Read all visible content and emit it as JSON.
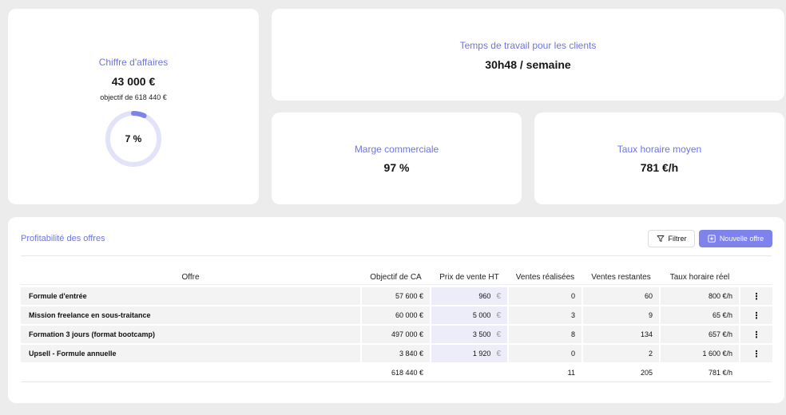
{
  "ca": {
    "title": "Chiffre d'affaires",
    "value": "43 000 €",
    "subtitle": "objectif de 618 440 €",
    "percent_label": "7 %",
    "percent": 0.07
  },
  "temps": {
    "title": "Temps de travail pour les clients",
    "value": "30h48 / semaine"
  },
  "marge": {
    "title": "Marge commerciale",
    "value": "97 %"
  },
  "taux": {
    "title": "Taux horaire moyen",
    "value": "781 €/h"
  },
  "table": {
    "title": "Profitabilité des offres",
    "filter_label": "Filtrer",
    "new_label": "Nouvelle offre",
    "headers": [
      "Offre",
      "Objectif de CA",
      "Prix de vente HT",
      "Ventes réalisées",
      "Ventes restantes",
      "Taux horaire réel"
    ],
    "rows": [
      {
        "offre": "Formule d'entrée",
        "objectif": "57 600 €",
        "prix": "960",
        "ventes": "0",
        "restantes": "60",
        "taux": "800 €/h"
      },
      {
        "offre": "Mission freelance en sous-traitance",
        "objectif": "60 000 €",
        "prix": "5 000",
        "ventes": "3",
        "restantes": "9",
        "taux": "65 €/h"
      },
      {
        "offre": "Formation 3 jours (format bootcamp)",
        "objectif": "497 000 €",
        "prix": "3 500",
        "ventes": "8",
        "restantes": "134",
        "taux": "657 €/h"
      },
      {
        "offre": "Upsell - Formule annuelle",
        "objectif": "3 840 €",
        "prix": "1 920",
        "ventes": "0",
        "restantes": "2",
        "taux": "1 600 €/h"
      }
    ],
    "currency_symbol": "€",
    "menu_symbol": "⋮",
    "totals": {
      "objectif": "618 440 €",
      "ventes": "11",
      "restantes": "205",
      "taux": "781 €/h"
    }
  },
  "colors": {
    "accent": "#6e74e6",
    "button": "#7d83ea",
    "ring_track": "#e2e3f8",
    "ring_fill": "#7d83ea"
  }
}
